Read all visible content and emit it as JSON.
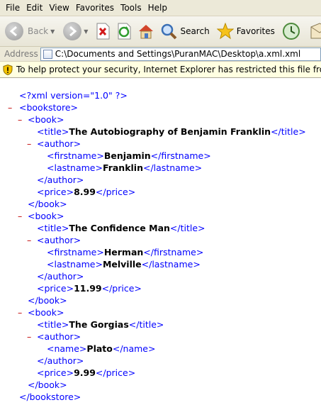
{
  "menu": [
    "File",
    "Edit",
    "View",
    "Favorites",
    "Tools",
    "Help"
  ],
  "toolbar": {
    "back_label": "Back",
    "search_label": "Search",
    "favorites_label": "Favorites"
  },
  "address": {
    "label": "Address",
    "value": "C:\\Documents and Settings\\PuranMAC\\Desktop\\a.xml.xml"
  },
  "infobar": {
    "text": "To help protect your security, Internet Explorer has restricted this file from showing active"
  },
  "xml": {
    "declaration": "<?xml version=\"1.0\" ?>",
    "root_open": "<bookstore>",
    "root_close": "</bookstore>",
    "book_open": "<book>",
    "book_close": "</book>",
    "author_open": "<author>",
    "author_close": "</author>",
    "books": [
      {
        "title": "The Autobiography of Benjamin Franklin",
        "author": {
          "firstname": "Benjamin",
          "lastname": "Franklin"
        },
        "price": "8.99"
      },
      {
        "title": "The Confidence Man",
        "author": {
          "firstname": "Herman",
          "lastname": "Melville"
        },
        "price": "11.99"
      },
      {
        "title": "The Gorgias",
        "author": {
          "name": "Plato"
        },
        "price": "9.99"
      }
    ],
    "tags": {
      "title_open": "<title>",
      "title_close": "</title>",
      "firstname_open": "<firstname>",
      "firstname_close": "</firstname>",
      "lastname_open": "<lastname>",
      "lastname_close": "</lastname>",
      "name_open": "<name>",
      "name_close": "</name>",
      "price_open": "<price>",
      "price_close": "</price>"
    },
    "collapse_glyph": "–"
  }
}
